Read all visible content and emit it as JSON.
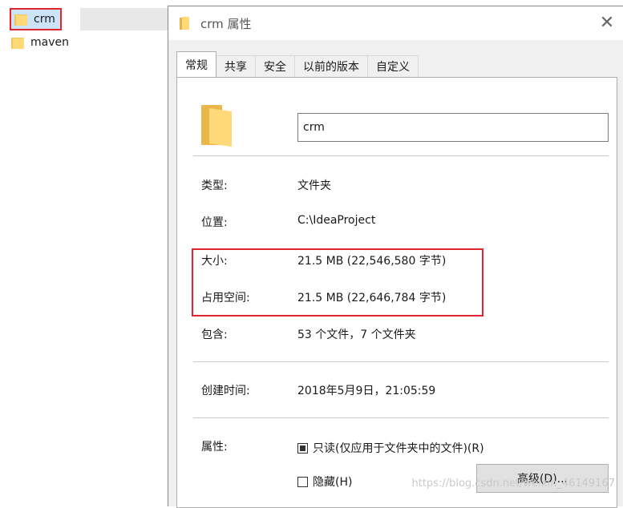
{
  "explorer": {
    "items": [
      {
        "label": "crm"
      },
      {
        "label": "maven"
      }
    ]
  },
  "dialog": {
    "title": "crm 属性",
    "close_glyph": "✕",
    "tabs": [
      {
        "label": "常规"
      },
      {
        "label": "共享"
      },
      {
        "label": "安全"
      },
      {
        "label": "以前的版本"
      },
      {
        "label": "自定义"
      }
    ],
    "name_value": "crm",
    "props": {
      "type_label": "类型:",
      "type_value": "文件夹",
      "location_label": "位置:",
      "location_value": "C:\\IdeaProject",
      "size_label": "大小:",
      "size_value": "21.5 MB (22,546,580 字节)",
      "disk_label": "占用空间:",
      "disk_value": "21.5 MB (22,646,784 字节)",
      "contains_label": "包含:",
      "contains_value": "53 个文件，7 个文件夹",
      "created_label": "创建时间:",
      "created_value": "2018年5月9日，21:05:59",
      "attributes_label": "属性:"
    },
    "attributes": {
      "readonly_label": "只读(仅应用于文件夹中的文件)(R)",
      "hidden_label": "隐藏(H)",
      "advanced_label": "高级(D)..."
    }
  },
  "watermark": "https://blog.csdn.net/weixin_46149167",
  "colors": {
    "highlight": "#e0262e",
    "folder": "#ffd978",
    "dialog_bg": "#f0f0f0"
  }
}
